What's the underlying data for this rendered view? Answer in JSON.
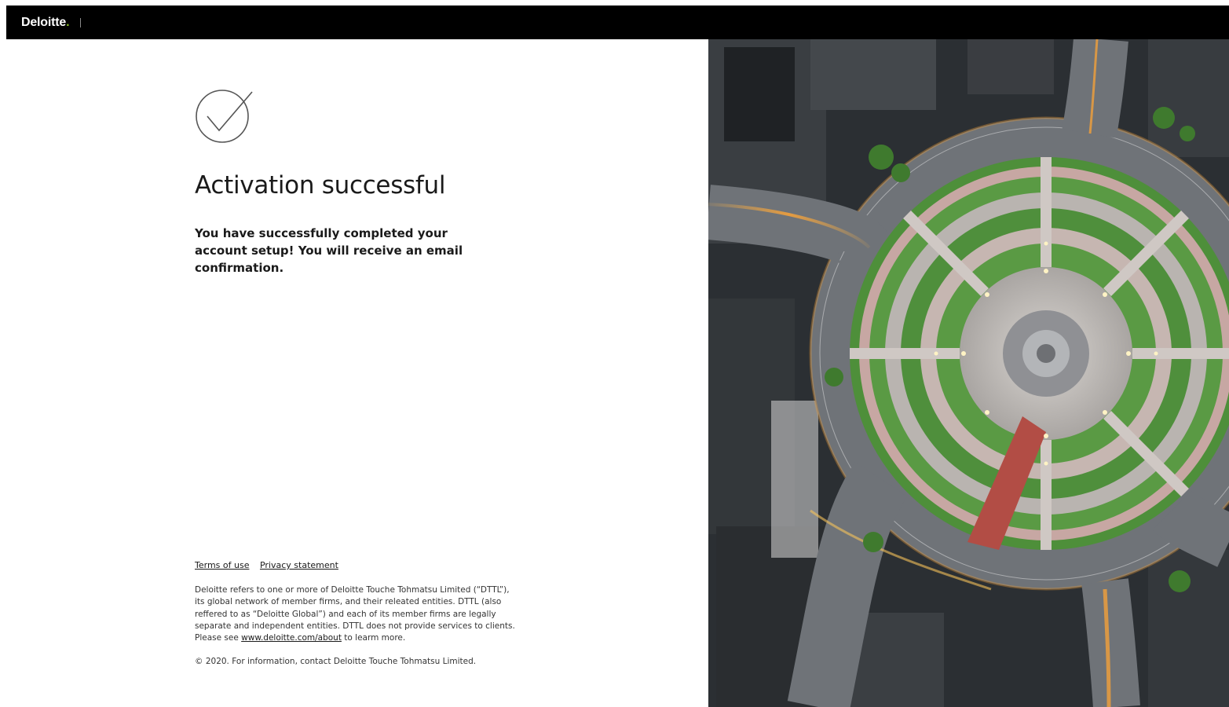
{
  "header": {
    "logo_text": "Deloitte",
    "logo_dot": ".",
    "background": "#000000",
    "accent": "#86bc25"
  },
  "main": {
    "status_icon": "check-circle-icon",
    "title": "Activation successful",
    "message": "You have successfully completed your account setup! You will receive an email confirmation."
  },
  "footer": {
    "links": [
      {
        "label": "Terms of use"
      },
      {
        "label": "Privacy statement"
      }
    ],
    "disclaimer_text": "Deloitte refers to one or more of Deloitte Touche Tohmatsu Limited (“DTTL”), its global network of member firms, and their releated entities. DTTL (also reffered to as “Deloitte Global”) and each of its member firms are legally separate and independent entities. DTTL does not provide services to clients. Please see ",
    "disclaimer_link": "www.deloitte.com/about",
    "disclaimer_suffix": " to learm more.",
    "copyright": "© 2020. For information, contact Deloitte Touche Tohmatsu Limited."
  },
  "hero": {
    "image": "aerial-roundabout-photo",
    "colors": {
      "road": "#6f7378",
      "grass": "#4e8f3a",
      "plaza": "#b9b4b0",
      "red_path": "#b24d45",
      "lights": "#f2a03a"
    }
  }
}
